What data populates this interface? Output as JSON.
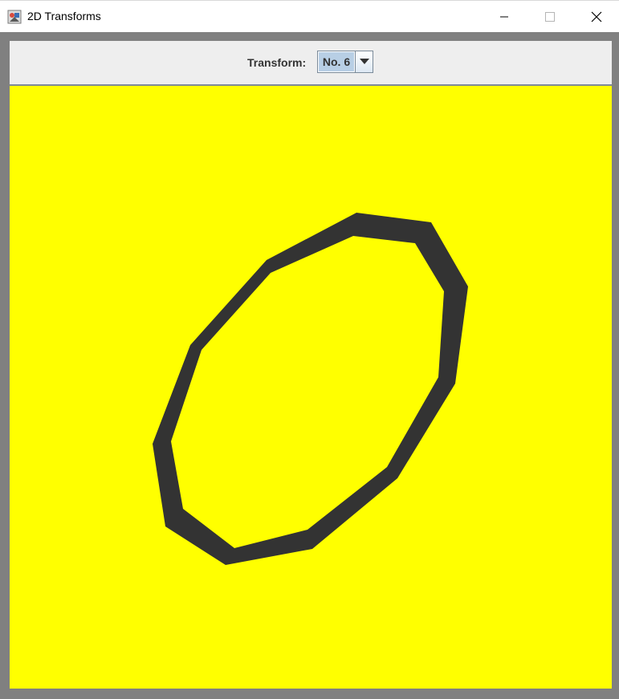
{
  "window": {
    "title": "2D Transforms",
    "icon": "java-app-icon"
  },
  "controls": {
    "minimize_icon": "minimize-icon",
    "maximize_icon": "maximize-icon",
    "close_icon": "close-icon"
  },
  "toolbar": {
    "transform_label": "Transform:",
    "transform_selected": "No. 6"
  },
  "canvas": {
    "background_color": "#ffff00",
    "shape_color": "#333333",
    "shape": "transformed-polygon-outline"
  }
}
